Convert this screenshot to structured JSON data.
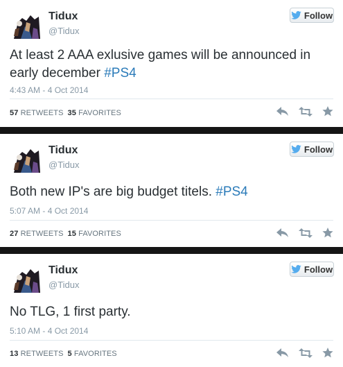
{
  "follow_label": "Follow",
  "tweets": [
    {
      "name": "Tidux",
      "handle": "@Tidux",
      "text": "At least 2 AAA exlusive games will be announced in early december ",
      "hashtag": "#PS4",
      "date": "4:43 AM - 4 Oct 2014",
      "retweets": "57",
      "retweets_label": "RETWEETS",
      "favorites": "35",
      "favorites_label": "FAVORITES"
    },
    {
      "name": "Tidux",
      "handle": "@Tidux",
      "text": "Both new IP's are big budget titels. ",
      "hashtag": "#PS4",
      "date": "5:07 AM - 4 Oct 2014",
      "retweets": "27",
      "retweets_label": "RETWEETS",
      "favorites": "15",
      "favorites_label": "FAVORITES"
    },
    {
      "name": "Tidux",
      "handle": "@Tidux",
      "text": "No TLG, 1 first party.",
      "hashtag": "",
      "date": "5:10 AM - 4 Oct 2014",
      "retweets": "13",
      "retweets_label": "RETWEETS",
      "favorites": "5",
      "favorites_label": "FAVORITES"
    }
  ],
  "icons": {
    "follow": "twitter-bird-icon",
    "reply": "reply-icon",
    "retweet": "retweet-icon",
    "favorite": "star-icon"
  },
  "colors": {
    "hashtag": "#2b7bb9",
    "meta": "#8899a6",
    "action_icon": "#8899a6",
    "separator": "#151515"
  }
}
